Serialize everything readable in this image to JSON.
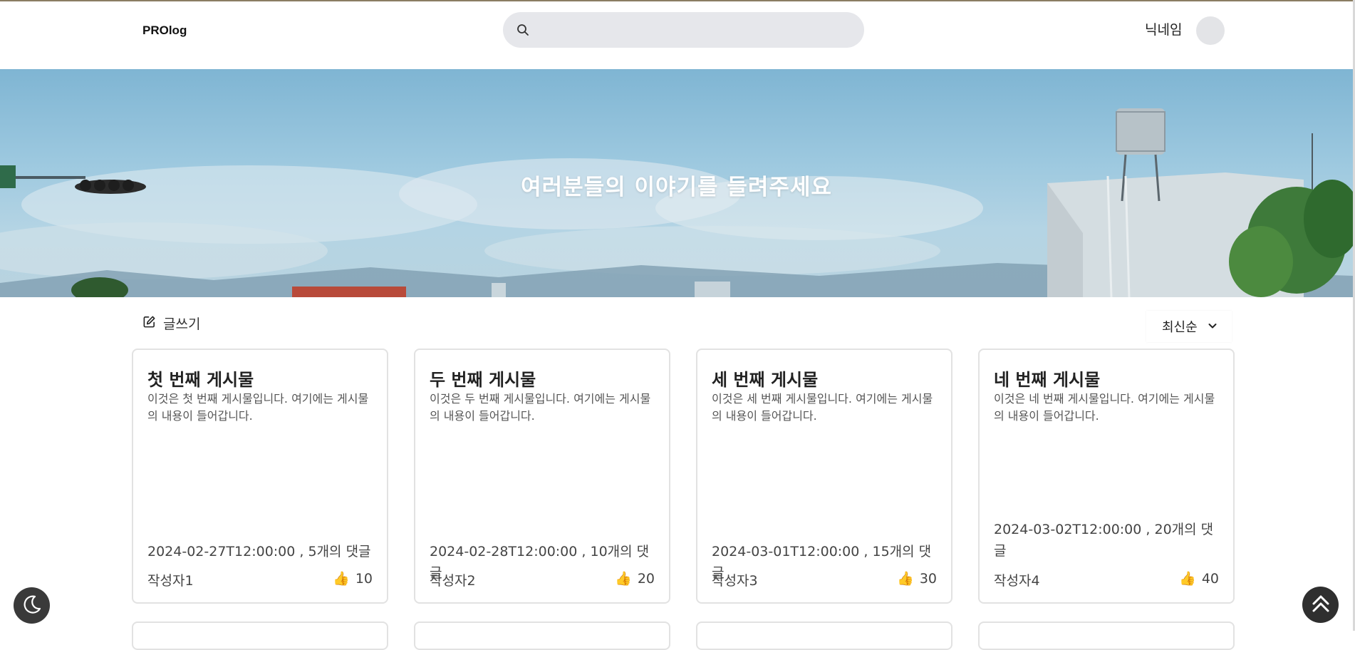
{
  "app": {
    "logo": "PROlog"
  },
  "search": {
    "placeholder": "",
    "value": ""
  },
  "user": {
    "nickname": "닉네임"
  },
  "hero": {
    "title": "여러분들의 이야기를 들려주세요"
  },
  "toolbar": {
    "write_label": "글쓰기",
    "sort_selected": "최신순"
  },
  "posts": [
    {
      "title": "첫 번째 게시물",
      "body": "이것은 첫 번째 게시물입니다. 여기에는 게시물의 내용이 들어갑니다.",
      "meta": "2024-02-27T12:00:00 , 5개의 댓글",
      "author": "작성자1",
      "likes": "10"
    },
    {
      "title": "두 번째 게시물",
      "body": "이것은 두 번째 게시물입니다. 여기에는 게시물의 내용이 들어갑니다.",
      "meta": "2024-02-28T12:00:00 , 10개의 댓글",
      "author": "작성자2",
      "likes": "20"
    },
    {
      "title": "세 번째 게시물",
      "body": "이것은 세 번째 게시물입니다. 여기에는 게시물의 내용이 들어갑니다.",
      "meta": "2024-03-01T12:00:00 , 15개의 댓글",
      "author": "작성자3",
      "likes": "30"
    },
    {
      "title": "네 번째 게시물",
      "body": "이것은 네 번째 게시물입니다. 여기에는 게시물의 내용이 들어갑니다.",
      "meta": "2024-03-02T12:00:00 , 20개의 댓글",
      "author": "작성자4",
      "likes": "40"
    }
  ],
  "icons": {
    "search": "search-icon",
    "write": "pencil-square-icon",
    "sort": "chevron-down-icon",
    "like": "thumbs-up-icon",
    "theme": "moon-icon",
    "scroll_top": "double-chevron-up-icon"
  },
  "colors": {
    "search_bg": "#e6e7eb",
    "card_border": "#e2e2e2",
    "float_button": "#2f2f2f"
  }
}
